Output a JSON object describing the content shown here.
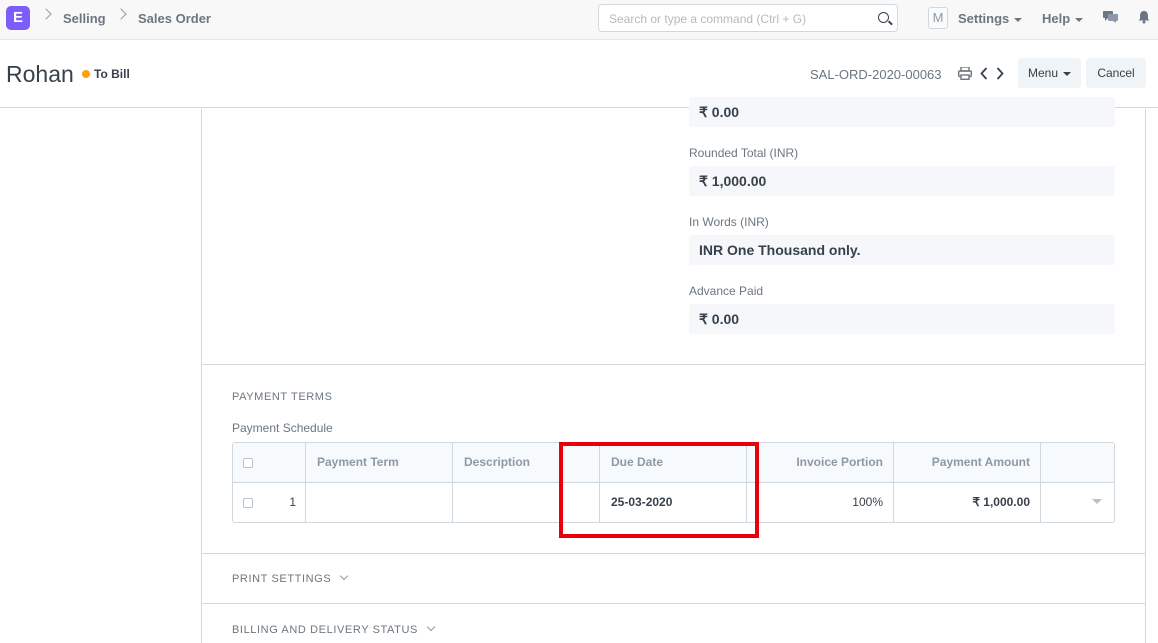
{
  "navbar": {
    "logo_letter": "E",
    "breadcrumbs": [
      "Selling",
      "Sales Order"
    ],
    "search_placeholder": "Search or type a command (Ctrl + G)",
    "avatar_letter": "M",
    "settings_label": "Settings",
    "help_label": "Help"
  },
  "page": {
    "title": "Rohan",
    "status": "To Bill",
    "status_color": "#ffa00a",
    "doc_name": "SAL-ORD-2020-00063",
    "menu_label": "Menu",
    "cancel_label": "Cancel"
  },
  "totals": {
    "top_value": "₹ 0.00",
    "rounded_total_label": "Rounded Total (INR)",
    "rounded_total_value": "₹ 1,000.00",
    "in_words_label": "In Words (INR)",
    "in_words_value": "INR One Thousand only.",
    "advance_paid_label": "Advance Paid",
    "advance_paid_value": "₹ 0.00"
  },
  "payment_terms": {
    "section_title": "PAYMENT TERMS",
    "schedule_label": "Payment Schedule",
    "columns": [
      "Payment Term",
      "Description",
      "Due Date",
      "Invoice Portion",
      "Payment Amount"
    ],
    "rows": [
      {
        "idx": "1",
        "payment_term": "",
        "description": "",
        "due_date": "25-03-2020",
        "invoice_portion": "100%",
        "payment_amount": "₹ 1,000.00"
      }
    ]
  },
  "sections": {
    "print_settings": "PRINT SETTINGS",
    "billing_delivery": "BILLING AND DELIVERY STATUS"
  },
  "highlight_color": "#e8000d"
}
